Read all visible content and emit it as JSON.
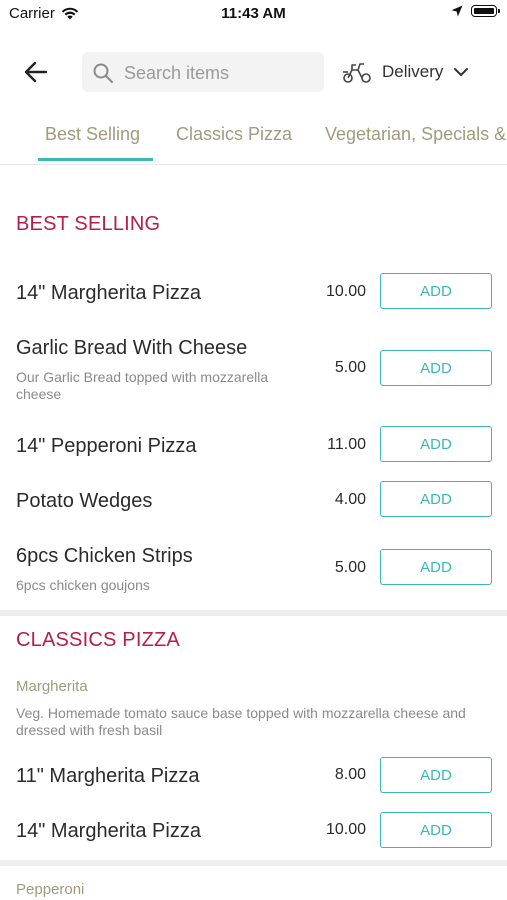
{
  "status": {
    "carrier": "Carrier",
    "time": "11:43 AM"
  },
  "header": {
    "search_placeholder": "Search items",
    "delivery_label": "Delivery"
  },
  "tabs": [
    {
      "label": "Best Selling",
      "active": true
    },
    {
      "label": "Classics Pizza",
      "active": false
    },
    {
      "label": "Vegetarian, Specials &",
      "active": false
    }
  ],
  "colors": {
    "accent": "#3cb6b6",
    "section_title": "#b61d4b",
    "tab_text": "#a29a7d"
  },
  "best_selling": {
    "title": "BEST SELLING",
    "items": [
      {
        "name": "14\" Margherita Pizza",
        "description": "",
        "price": "10.00",
        "button": "ADD"
      },
      {
        "name": "Garlic Bread With Cheese",
        "description": "Our Garlic Bread topped with mozzarella cheese",
        "price": "5.00",
        "button": "ADD"
      },
      {
        "name": "14\" Pepperoni Pizza",
        "description": "",
        "price": "11.00",
        "button": "ADD"
      },
      {
        "name": "Potato Wedges",
        "description": "",
        "price": "4.00",
        "button": "ADD"
      },
      {
        "name": "6pcs Chicken Strips",
        "description": "6pcs chicken goujons",
        "price": "5.00",
        "button": "ADD"
      }
    ]
  },
  "classics_pizza": {
    "title": "CLASSICS PIZZA",
    "groups": [
      {
        "name": "Margherita",
        "description": "Veg. Homemade tomato sauce base topped with mozzarella cheese and dressed with fresh basil",
        "items": [
          {
            "name": "11\" Margherita Pizza",
            "price": "8.00",
            "button": "ADD"
          },
          {
            "name": "14\" Margherita Pizza",
            "price": "10.00",
            "button": "ADD"
          }
        ]
      },
      {
        "name": "Pepperoni"
      }
    ]
  }
}
